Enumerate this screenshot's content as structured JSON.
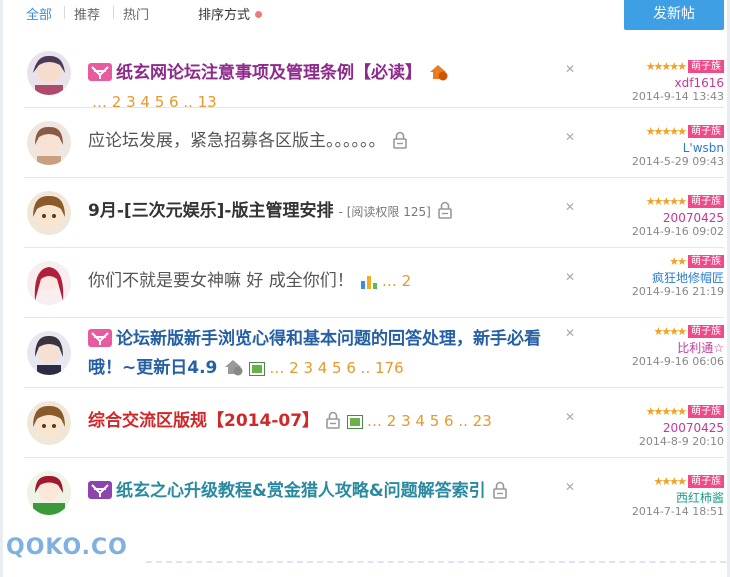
{
  "nav": {
    "tabs": [
      "全部",
      "推荐",
      "热门"
    ],
    "sort_label": "排序方式",
    "post_button": "发新帖"
  },
  "threads": [
    {
      "title": "纸玄网论坛注意事项及管理条例【必读】",
      "pages": "… 2 3 4 5 6 .. 13",
      "author": "xdf1616",
      "time": "2014-9-14 13:43",
      "badge": "萌子族",
      "stars": "★★★★★"
    },
    {
      "title": "应论坛发展，紧急招募各区版主。。。。。。",
      "pages": "",
      "author": "L'wsbn",
      "time": "2014-5-29 09:43",
      "badge": "萌子族",
      "stars": "★★★★★"
    },
    {
      "title": "9月-[三次元娱乐]-版主管理安排",
      "perm": "- [阅读权限 125]",
      "pages": "",
      "author": "20070425",
      "time": "2014-9-16 09:02",
      "badge": "萌子族",
      "stars": "★★★★★"
    },
    {
      "title": "你们不就是要女神嘛 好 成全你们！",
      "pages": "… 2",
      "author": "疯狂地修帽匠",
      "time": "2014-9-16 21:19",
      "badge": "萌子族",
      "stars": "★★"
    },
    {
      "title": "论坛新版新手浏览心得和基本问题的回答处理，新手必看哦！~更新日4.9",
      "pages": "… 2 3 4 5 6 .. 176",
      "author": "比利通☆",
      "time": "2014-9-16 06:06",
      "badge": "萌子族",
      "stars": "★★★★"
    },
    {
      "title": "综合交流区版规【2014-07】",
      "pages": "… 2 3 4 5 6 .. 23",
      "author": "20070425",
      "time": "2014-8-9 20:10",
      "badge": "萌子族",
      "stars": "★★★★★"
    },
    {
      "title": "纸玄之心升级教程&赏金猎人攻略&问题解答索引",
      "pages": "",
      "author": "西红柿酱",
      "time": "2014-7-14 18:51",
      "badge": "萌子族",
      "stars": "★★★★"
    }
  ],
  "watermark": "QOKO.CO",
  "colors": {
    "accent": "#3f9fe4",
    "badge": "#ee4b8b",
    "pages": "#e49a2c"
  }
}
